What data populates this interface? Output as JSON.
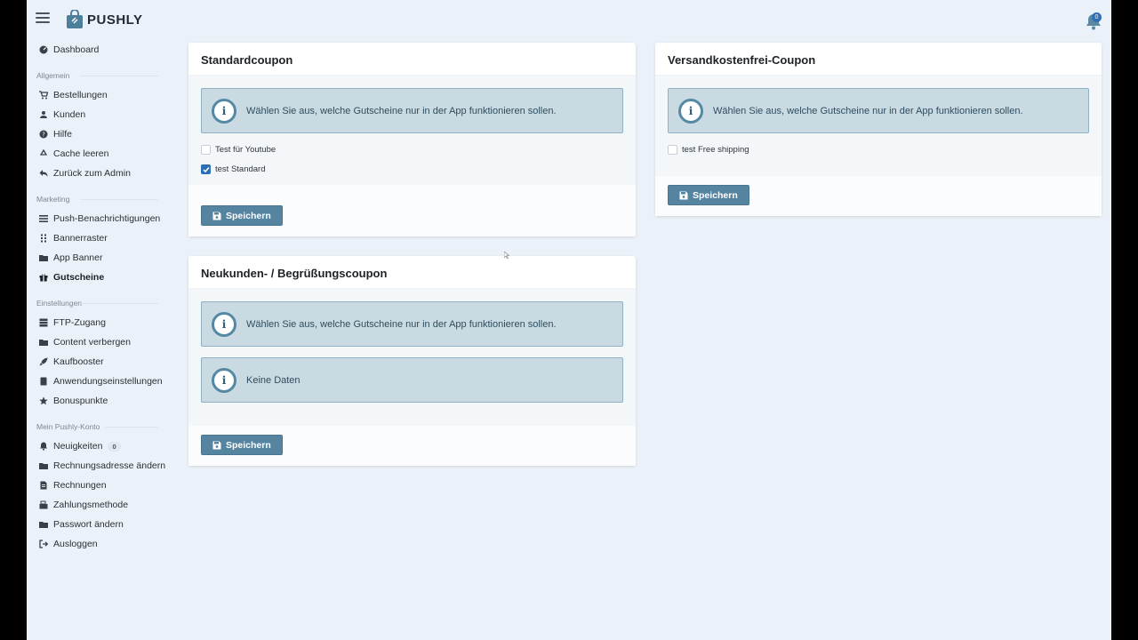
{
  "app": {
    "brand": "PUSHLY",
    "notification_count": "0"
  },
  "sidebar": {
    "dashboard": "Dashboard",
    "sections": {
      "allgemein": "Allgemein",
      "marketing": "Marketing",
      "einstellungen": "Einstellungen",
      "konto": "Mein Pushly-Konto"
    },
    "items": {
      "bestellungen": "Bestellungen",
      "kunden": "Kunden",
      "hilfe": "Hilfe",
      "cache": "Cache leeren",
      "zurueck": "Zurück zum Admin",
      "push": "Push-Benachrichtigungen",
      "bannerraster": "Bannerraster",
      "appbanner": "App Banner",
      "gutscheine": "Gutscheine",
      "ftp": "FTP-Zugang",
      "content": "Content verbergen",
      "kaufbooster": "Kaufbooster",
      "anwendung": "Anwendungseinstellungen",
      "bonuspunkte": "Bonuspunkte",
      "neuigkeiten": "Neuigkeiten",
      "neuigkeiten_count": "0",
      "rechnungsadresse": "Rechnungsadresse ändern",
      "rechnungen": "Rechnungen",
      "zahlungsmethode": "Zahlungsmethode",
      "passwort": "Passwort ändern",
      "ausloggen": "Ausloggen"
    }
  },
  "cards": {
    "standard": {
      "title": "Standardcoupon",
      "info": "Wählen Sie aus, welche Gutscheine nur in der App funktionieren sollen.",
      "options": [
        {
          "label": "Test für Youtube",
          "checked": false
        },
        {
          "label": "test Standard",
          "checked": true
        }
      ],
      "save": "Speichern"
    },
    "versand": {
      "title": "Versandkostenfrei-Coupon",
      "info": "Wählen Sie aus, welche Gutscheine nur in der App funktionieren sollen.",
      "options": [
        {
          "label": "test Free shipping",
          "checked": false
        }
      ],
      "save": "Speichern"
    },
    "neukunden": {
      "title": "Neukunden- / Begrüßungscoupon",
      "info": "Wählen Sie aus, welche Gutscheine nur in der App funktionieren sollen.",
      "empty": "Keine Daten",
      "save": "Speichern"
    }
  },
  "colors": {
    "accent": "#5584a1",
    "info_bg": "#c9dae3",
    "checkbox": "#2f6fb5",
    "page_bg": "#ebf1f8"
  }
}
